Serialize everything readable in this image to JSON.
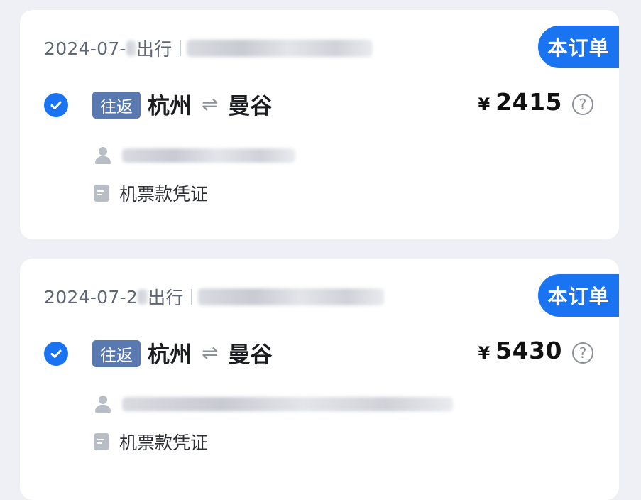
{
  "orders": [
    {
      "date_prefix": "2024-07-",
      "date_suffix": "出行",
      "badge": "本订单",
      "trip_type": "往返",
      "origin": "杭州",
      "swap_symbol": "⇌",
      "destination": "曼谷",
      "currency": "¥",
      "price": "2415",
      "voucher": "机票款凭证"
    },
    {
      "date_prefix": "2024-07-2",
      "date_suffix": "出行",
      "badge": "本订单",
      "trip_type": "往返",
      "origin": "杭州",
      "swap_symbol": "⇌",
      "destination": "曼谷",
      "currency": "¥",
      "price": "5430",
      "voucher": "机票款凭证"
    }
  ],
  "icons": {
    "check": "check-circle-icon",
    "help": "question-circle-icon",
    "person": "person-icon",
    "document": "document-icon"
  },
  "colors": {
    "accent": "#1a73f0",
    "trip_tag": "#5a79b0",
    "background": "#eef0f6"
  }
}
